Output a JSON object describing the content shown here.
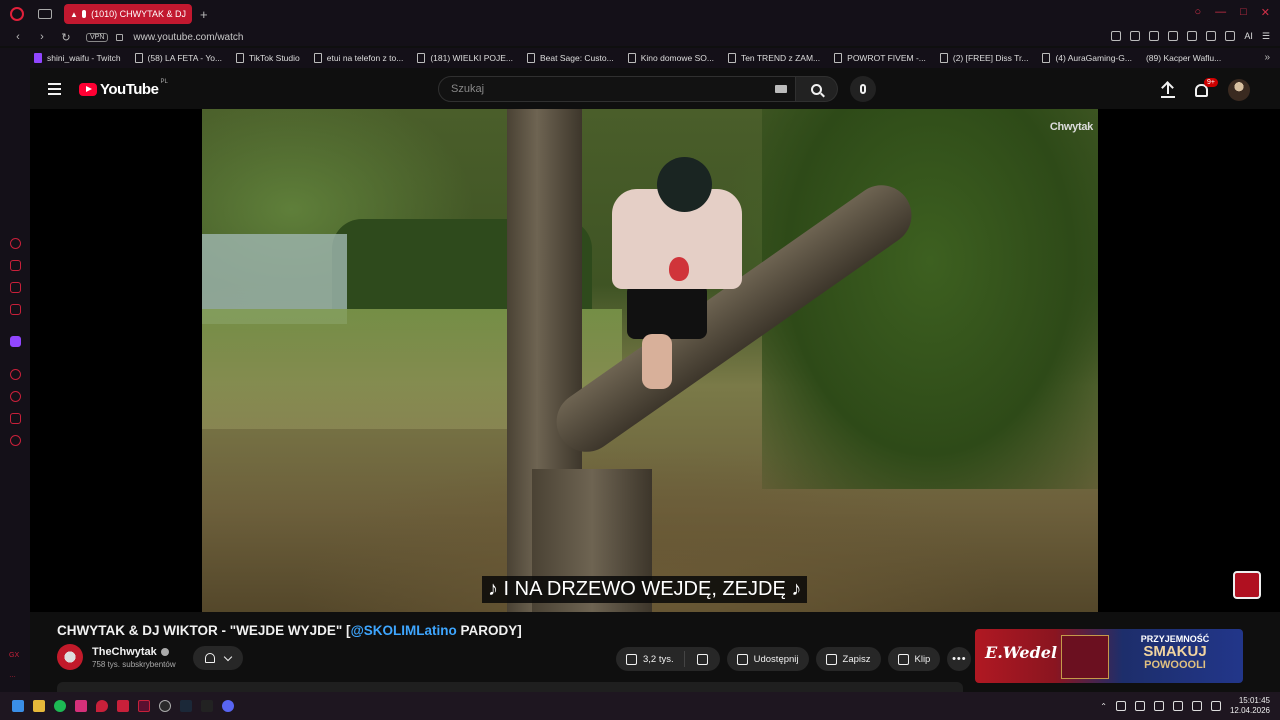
{
  "browser": {
    "tab_title": "(1010) CHWYTAK & DJ",
    "new_tab": "+",
    "url": "www.youtube.com/watch",
    "vpn_label": "VPN",
    "ai_label": "AI",
    "bookmarks": [
      "shini_waifu - Twitch",
      "(58) LA FETA - Yo...",
      "TikTok Studio",
      "etui na telefon z to...",
      "(181) WIELKI POJE...",
      "Beat Sage: Custo...",
      "Kino domowe SO...",
      "Ten TREND z ZAM...",
      "POWROT FIVEM -...",
      "(2) [FREE] Diss Tr...",
      "(4) AuraGaming-G...",
      "(89) Kacper Waflu..."
    ]
  },
  "youtube": {
    "logo_text": "YouTube",
    "region": "PL",
    "search_placeholder": "Szukaj",
    "notification_badge": "9+",
    "video": {
      "watermark": "Chwytak",
      "subtitle": "♪ I NA DRZEWO WEJDĘ, ZEJDĘ ♪"
    },
    "title_prefix": "CHWYTAK & DJ WIKTOR - \"WEJDE WYJDE\" [",
    "title_link": "@SKOLIMLatino",
    "title_suffix": " PARODY]",
    "channel_name": "TheChwytak",
    "channel_subs": "758 tys. subskrybentów",
    "actions": {
      "likes": "3,2 tys.",
      "share": "Udostępnij",
      "save": "Zapisz",
      "clip": "Klip",
      "more": "•••"
    },
    "ad": {
      "brand": "E.Wedel",
      "line1": "PRZYJEMNOŚĆ",
      "line2": "SMAKUJ",
      "line3": "POWOOOLI"
    }
  },
  "sidebar": {
    "bottom_label": "GX"
  },
  "taskbar": {
    "time": "15:01:45",
    "date": "12.04.2026"
  },
  "colors": {
    "accent": "#c2182f",
    "yt_red": "#ff0033",
    "link": "#3ea6ff"
  }
}
